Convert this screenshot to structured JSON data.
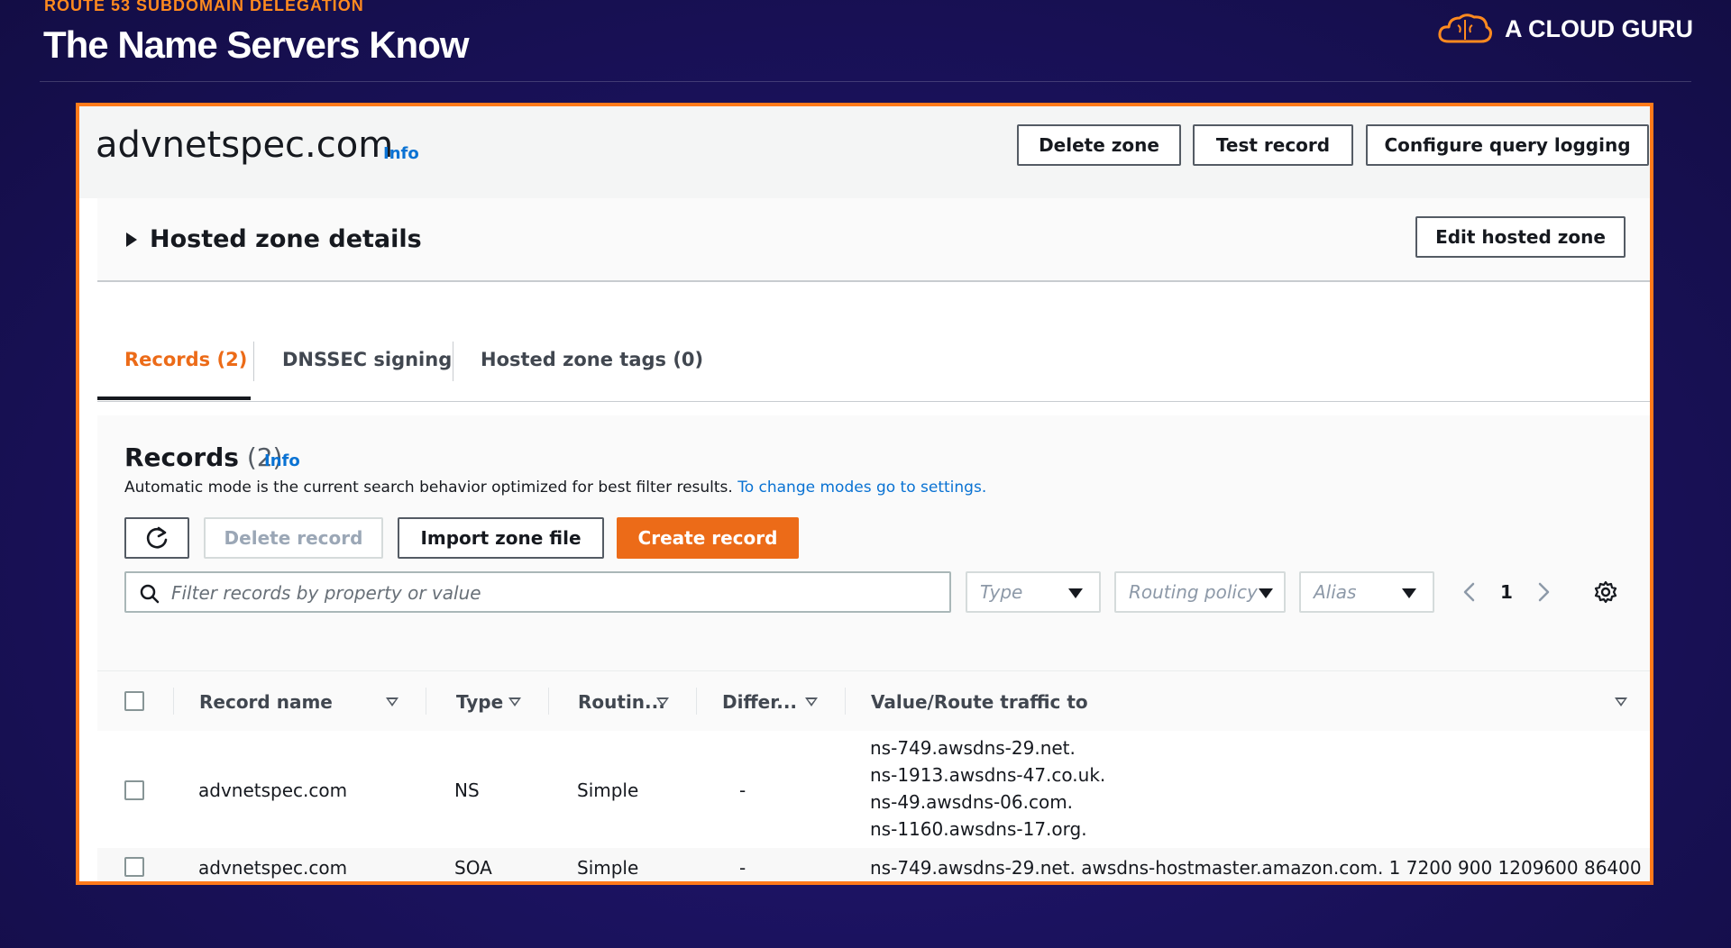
{
  "slide": {
    "kicker": "ROUTE 53 SUBDOMAIN DELEGATION",
    "title": "The Name Servers Know",
    "brand": "A CLOUD GURU",
    "brand_color": "#ff8a1f"
  },
  "zone": {
    "name": "advnetspec.com",
    "info_label": "Info",
    "buttons": {
      "delete_zone": "Delete zone",
      "test_record": "Test record",
      "configure_logging": "Configure query logging"
    }
  },
  "details": {
    "title": "Hosted zone details",
    "edit_label": "Edit hosted zone"
  },
  "tabs": [
    {
      "label": "Records (2)",
      "active": true
    },
    {
      "label": "DNSSEC signing",
      "active": false
    },
    {
      "label": "Hosted zone tags (0)",
      "active": false
    }
  ],
  "records": {
    "title": "Records",
    "count": "(2)",
    "info_label": "Info",
    "description": "Automatic mode is the current search behavior optimized for best filter results.",
    "settings_link": "To change modes go to settings.",
    "toolbar": {
      "delete_record": "Delete record",
      "import_zone_file": "Import zone file",
      "create_record": "Create record"
    },
    "search_placeholder": "Filter records by property or value",
    "filters": {
      "type": "Type",
      "routing_policy": "Routing policy",
      "alias": "Alias"
    },
    "page": "1",
    "columns": {
      "record_name": "Record name",
      "type": "Type",
      "routing": "Routin...",
      "differentiator": "Differ...",
      "value": "Value/Route traffic to"
    },
    "rows": [
      {
        "name": "advnetspec.com",
        "type": "NS",
        "routing": "Simple",
        "differentiator": "-",
        "values": [
          "ns-749.awsdns-29.net.",
          "ns-1913.awsdns-47.co.uk.",
          "ns-49.awsdns-06.com.",
          "ns-1160.awsdns-17.org."
        ]
      },
      {
        "name": "advnetspec.com",
        "type": "SOA",
        "routing": "Simple",
        "differentiator": "-",
        "values": [
          "ns-749.awsdns-29.net. awsdns-hostmaster.amazon.com. 1 7200 900 1209600 86400"
        ]
      }
    ]
  },
  "colors": {
    "accent_orange": "#ec6b18",
    "link_blue": "#0972d3",
    "frame_orange": "#ff7a1a"
  }
}
